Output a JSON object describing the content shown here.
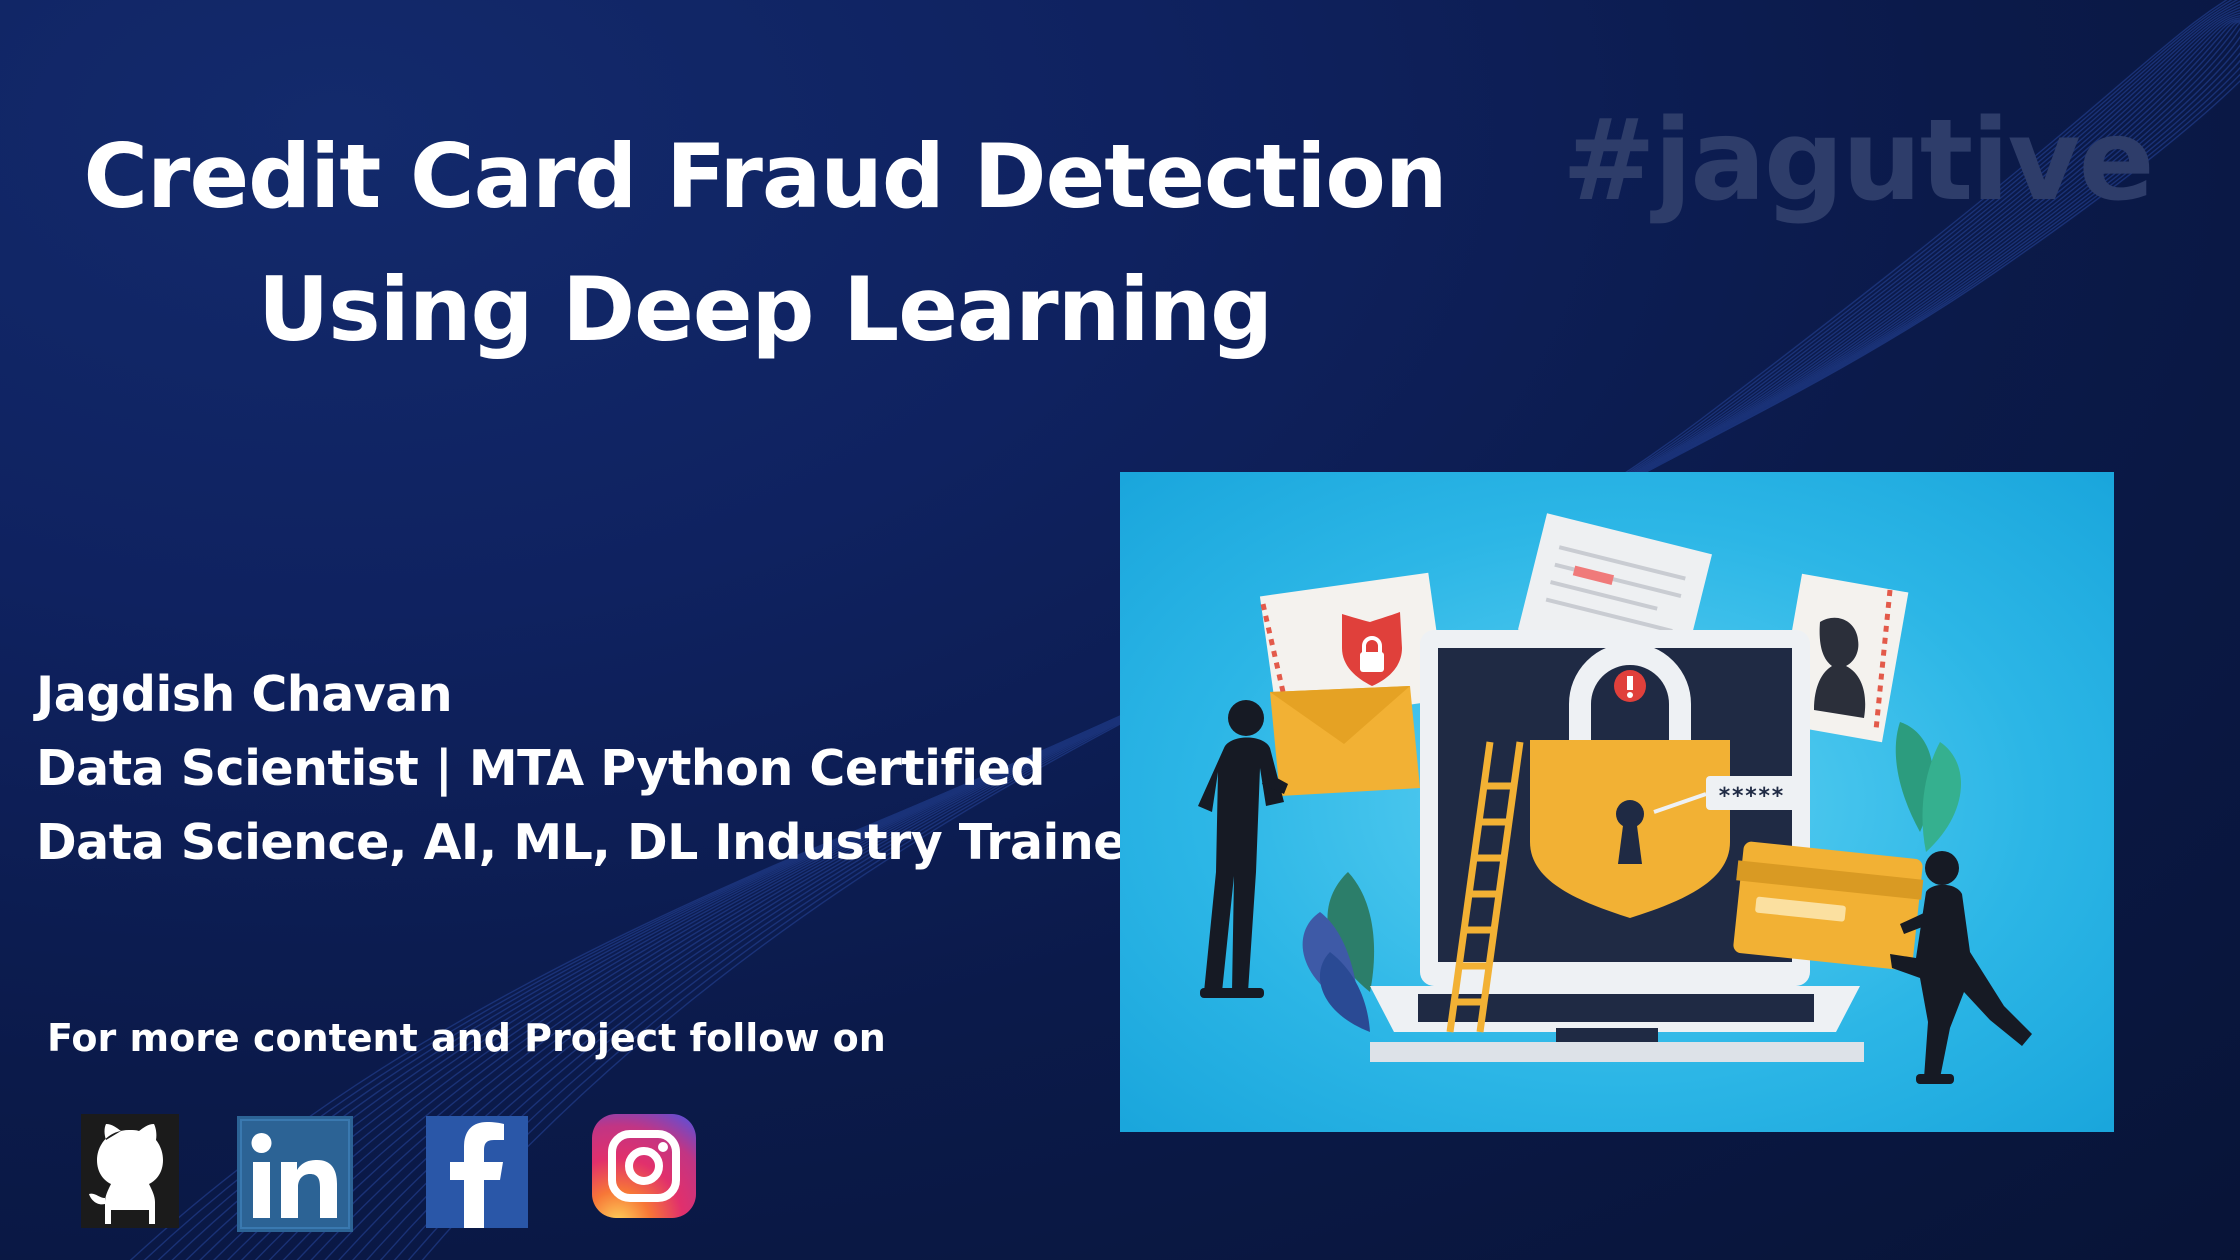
{
  "title": {
    "line1": "Credit Card Fraud Detection",
    "line2": "Using Deep Learning"
  },
  "hashtag": "#jagutive",
  "author": {
    "name": "Jagdish Chavan",
    "role": "Data Scientist | MTA Python Certified",
    "tagline": "Data Science, AI, ML, DL Industry Trainer"
  },
  "follow_text": "For more content and Project follow on",
  "socials": [
    {
      "name": "github-icon",
      "color": "#1b1b1b"
    },
    {
      "name": "linkedin-icon",
      "color": "#2c6395"
    },
    {
      "name": "facebook-icon",
      "color": "#2a57a8"
    },
    {
      "name": "instagram-icon",
      "color": "#d62976"
    }
  ],
  "illustration": {
    "background": "#2cb6e6",
    "password_mask": "*****"
  },
  "colors": {
    "background": "#0c1c4d",
    "title": "#ffffff",
    "hashtag": "#2e3d6a"
  }
}
